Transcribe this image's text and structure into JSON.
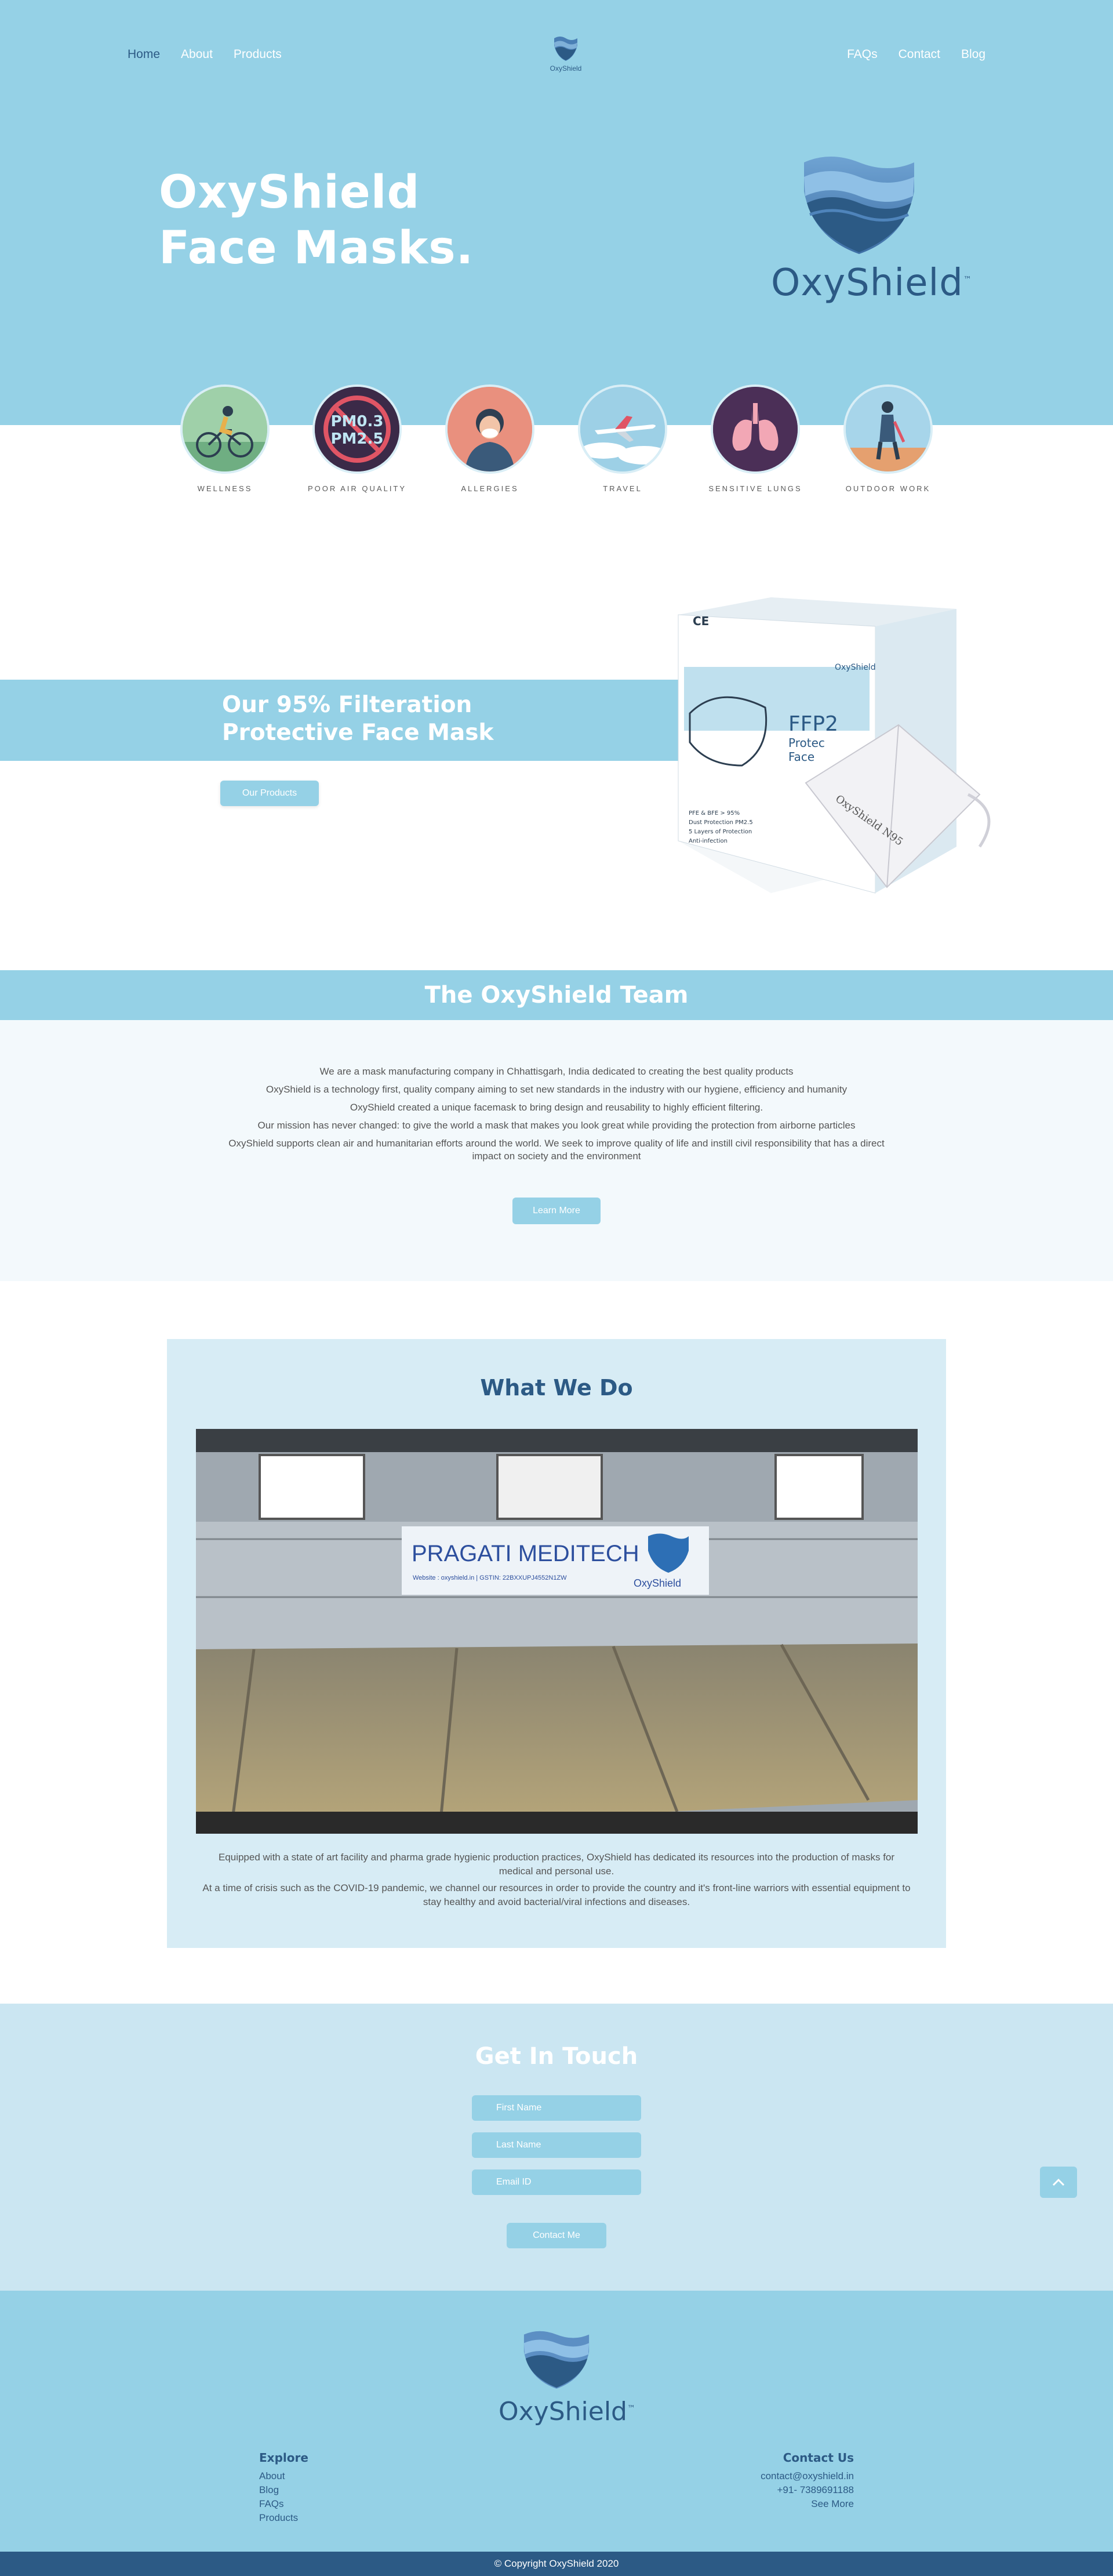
{
  "nav": {
    "left": [
      "Home",
      "About",
      "Products"
    ],
    "right": [
      "FAQs",
      "Contact",
      "Blog"
    ],
    "logo_text": "OxyShield"
  },
  "hero": {
    "title_line1": "OxyShield",
    "title_line2": "Face Masks.",
    "logo_text": "OxyShield",
    "logo_tm": "™"
  },
  "usecases": [
    {
      "label": "WELLNESS",
      "icon": "cyclist-icon"
    },
    {
      "label": "POOR AIR QUALITY",
      "icon": "pm-particles-icon"
    },
    {
      "label": "ALLERGIES",
      "icon": "allergy-person-icon"
    },
    {
      "label": "TRAVEL",
      "icon": "airplane-icon"
    },
    {
      "label": "SENSITIVE LUNGS",
      "icon": "lungs-icon"
    },
    {
      "label": "OUTDOOR WORK",
      "icon": "worker-icon"
    }
  ],
  "pm_text": {
    "line1": "PM0.3",
    "line2": "PM2.5"
  },
  "filtration": {
    "title_line1": "Our 95% Filteration",
    "title_line2": "Protective Face Mask",
    "button": "Our Products",
    "box_label": "FFP2",
    "box_sub1": "Protec",
    "box_sub2": "Face",
    "box_logo": "OxyShield",
    "mask_text": "OxyShield N95",
    "features": [
      "PFE & BFE > 95%",
      "Dust Protection PM2.5",
      "5 Layers of Protection",
      "Anti-infection"
    ]
  },
  "team": {
    "title": "The OxyShield Team",
    "lines": [
      "We are a mask manufacturing company in Chhattisgarh, India dedicated to creating the best quality products",
      "OxyShield is a technology first, quality company aiming to set new standards in the industry with our hygiene, efficiency and humanity",
      "OxyShield created a unique facemask to bring design and reusability to highly efficient filtering.",
      "Our mission has never changed: to give the world a mask that makes you look great while providing the protection from airborne particles",
      "OxyShield supports clean air and humanitarian efforts around the world. We seek to improve quality of life and instill civil responsibility that has a direct impact on society and the environment"
    ],
    "button": "Learn More"
  },
  "whatwedo": {
    "title": "What We Do",
    "banner_title": "PRAGATI MEDITECH",
    "banner_sub": "Website : oxyshield.in | GSTIN: 22BXXUPJ4552N1ZW",
    "banner_logo": "OxyShield",
    "lines": [
      "Equipped with a state of art facility and pharma grade hygienic production practices, OxyShield has dedicated its resources into the production of masks for medical and personal use.",
      "At a time of crisis such as the COVID-19 pandemic, we channel our resources in order to provide the country and it's front-line warriors with essential equipment to stay healthy and avoid bacterial/viral infections and diseases."
    ]
  },
  "contact": {
    "title": "Get In Touch",
    "first_name_placeholder": "First Name",
    "last_name_placeholder": "Last Name",
    "email_placeholder": "Email ID",
    "button": "Contact Me"
  },
  "footer": {
    "logo_text": "OxyShield",
    "logo_tm": "™",
    "explore_heading": "Explore",
    "explore_items": [
      "About",
      "Blog",
      "FAQs",
      "Products"
    ],
    "contact_heading": "Contact Us",
    "contact_items": [
      "contact@oxyshield.in",
      "+91- 7389691188",
      "See More"
    ],
    "copyright": "© Copyright OxyShield 2020"
  },
  "colors": {
    "primary": "#95d1e6",
    "navy": "#2c5a85",
    "light_bg": "#cbe6f2",
    "panel_bg": "#d7ecf5"
  }
}
